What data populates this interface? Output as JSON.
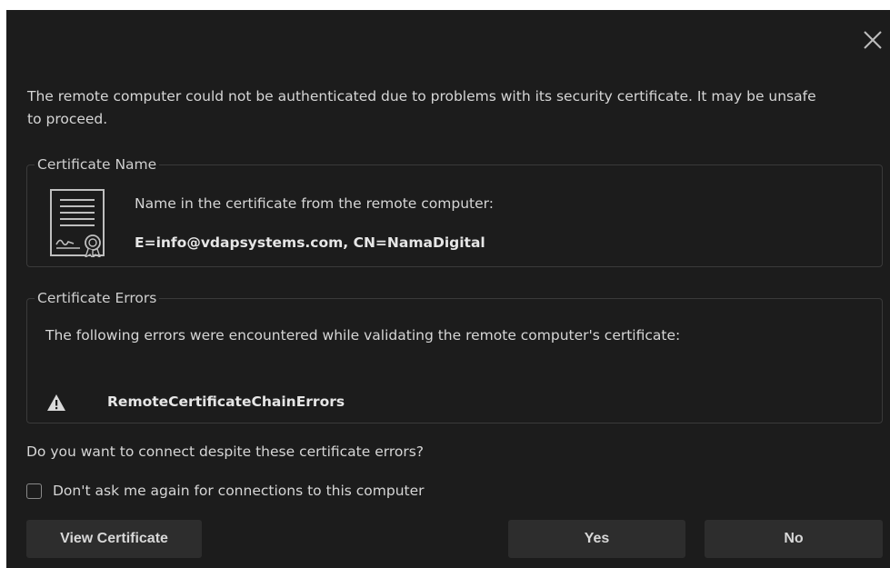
{
  "dialog": {
    "intro": "The remote computer could not be authenticated due to problems with its security certificate. It may be unsafe to proceed.",
    "certificate_name": {
      "legend": "Certificate Name",
      "caption": "Name in the certificate from the remote computer:",
      "value": "E=info@vdapsystems.com, CN=NamaDigital",
      "icon": "certificate-icon"
    },
    "certificate_errors": {
      "legend": "Certificate Errors",
      "caption": "The following errors were encountered while validating the remote computer's certificate:",
      "value": "RemoteCertificateChainErrors",
      "icon": "warning-icon"
    },
    "question": "Do you want to connect despite these certificate errors?",
    "dont_ask": {
      "label": "Don't ask me again for connections to this computer",
      "checked": false
    },
    "buttons": {
      "view_certificate": "View Certificate",
      "yes": "Yes",
      "no": "No"
    }
  },
  "colors": {
    "background": "#1c1c1c",
    "button": "#2d2d2d",
    "border": "#3a3a3a",
    "text": "#d6d6d6"
  }
}
